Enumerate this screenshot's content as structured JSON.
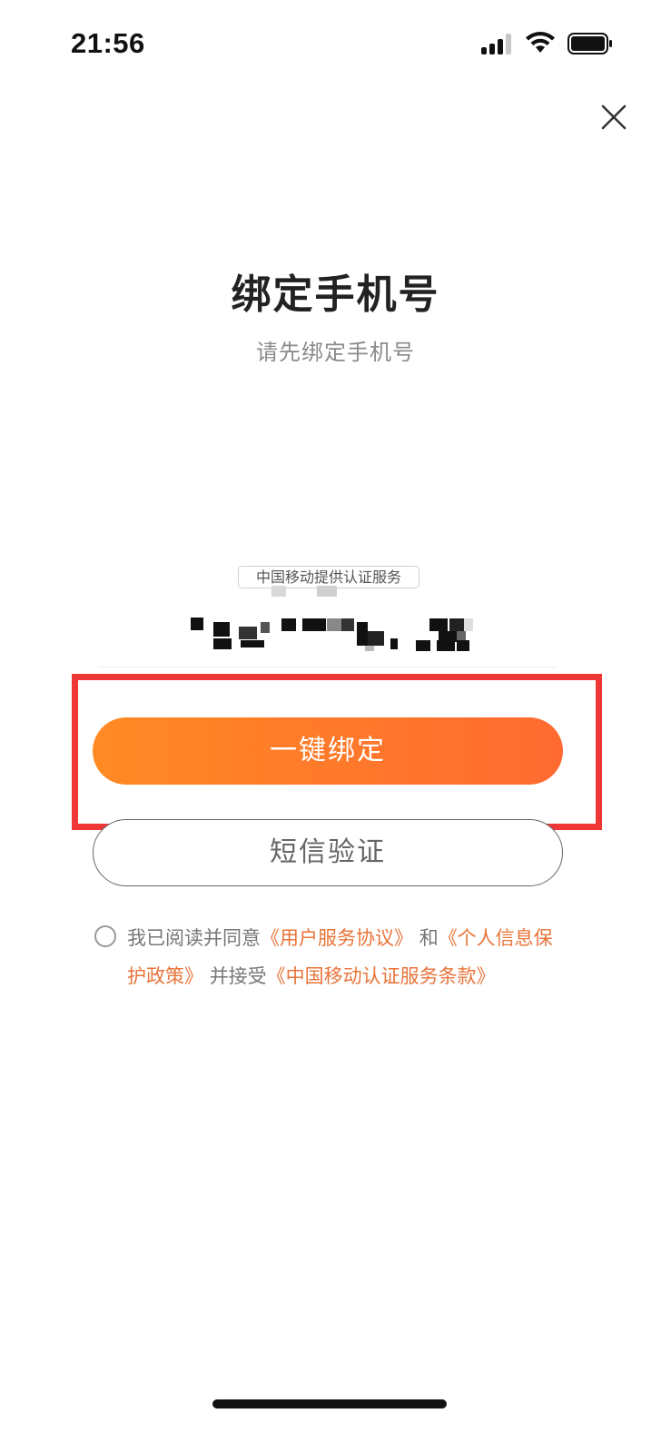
{
  "status_bar": {
    "time": "21:56",
    "signal_bars_active": 3,
    "battery_level_percent": 90
  },
  "header": {
    "close_icon": "close-icon"
  },
  "page": {
    "title": "绑定手机号",
    "subtitle": "请先绑定手机号"
  },
  "carrier": {
    "label": "中国移动提供认证服务"
  },
  "buttons": {
    "one_click_bind": "一键绑定",
    "sms_verify": "短信验证"
  },
  "agreement": {
    "prefix": "我已阅读并同意",
    "user_agreement": "《用户服务协议》",
    "and": "和",
    "privacy_policy": "《个人信息保护政策》",
    "accept": "并接受",
    "carrier_terms": "《中国移动认证服务条款》"
  },
  "colors": {
    "accent_start": "#ff8a24",
    "accent_end": "#ff6a30",
    "link": "#e8743a",
    "highlight_box": "#ef3737"
  }
}
